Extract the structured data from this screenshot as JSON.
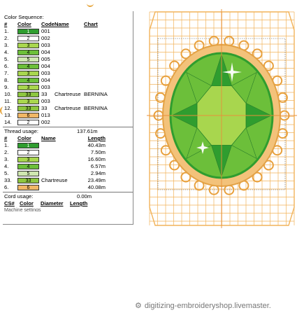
{
  "panel": {
    "color_sequence_title": "Color Sequence:",
    "seq_headers": [
      "#",
      "Color",
      "Code",
      "Name",
      "Chart"
    ],
    "sequence": [
      {
        "num": "1.",
        "swatch": "1",
        "code": "001",
        "name": "",
        "chart": "",
        "color": "#2f9d2f",
        "text_color": "#ffffff"
      },
      {
        "num": "2.",
        "swatch": "2",
        "code": "002",
        "name": "",
        "chart": "",
        "color": "#ffffff",
        "text_color": "#000000"
      },
      {
        "num": "3.",
        "swatch": "3",
        "code": "003",
        "name": "",
        "chart": "",
        "color": "#a8d64e",
        "text_color": "#000000"
      },
      {
        "num": "4.",
        "swatch": "4",
        "code": "004",
        "name": "",
        "chart": "",
        "color": "#6cbf3a",
        "text_color": "#000000"
      },
      {
        "num": "5.",
        "swatch": "5",
        "code": "005",
        "name": "",
        "chart": "",
        "color": "#cfe7b0",
        "text_color": "#000000"
      },
      {
        "num": "6.",
        "swatch": "4",
        "code": "004",
        "name": "",
        "chart": "",
        "color": "#6cbf3a",
        "text_color": "#000000"
      },
      {
        "num": "7.",
        "swatch": "3",
        "code": "003",
        "name": "",
        "chart": "",
        "color": "#a8d64e",
        "text_color": "#000000"
      },
      {
        "num": "8.",
        "swatch": "4",
        "code": "004",
        "name": "",
        "chart": "",
        "color": "#6cbf3a",
        "text_color": "#000000"
      },
      {
        "num": "9.",
        "swatch": "3",
        "code": "003",
        "name": "",
        "chart": "",
        "color": "#a8d64e",
        "text_color": "#000000"
      },
      {
        "num": "10.",
        "swatch": "33",
        "code": "33",
        "name": "Chartreuse",
        "chart": "BERNINA",
        "color": "#8dc63f",
        "text_color": "#000000"
      },
      {
        "num": "11.",
        "swatch": "3",
        "code": "003",
        "name": "",
        "chart": "",
        "color": "#a8d64e",
        "text_color": "#000000"
      },
      {
        "num": "12.",
        "swatch": "33",
        "code": "33",
        "name": "Chartreuse",
        "chart": "BERNINA",
        "color": "#8dc63f",
        "text_color": "#000000"
      },
      {
        "num": "13.",
        "swatch": "6",
        "code": "013",
        "name": "",
        "chart": "",
        "color": "#f0b766",
        "text_color": "#000000"
      },
      {
        "num": "14.",
        "swatch": "2",
        "code": "002",
        "name": "",
        "chart": "",
        "color": "#ffffff",
        "text_color": "#000000"
      }
    ],
    "thread_usage_label": "Thread usage:",
    "thread_usage_value": "137.61m",
    "thread_headers": [
      "#",
      "Color",
      "Name",
      "Length"
    ],
    "threads": [
      {
        "num": "1.",
        "swatch": "1",
        "name": "",
        "length": "40.43m",
        "color": "#2f9d2f",
        "text_color": "#ffffff"
      },
      {
        "num": "2.",
        "swatch": "2",
        "name": "",
        "length": "7.50m",
        "color": "#ffffff",
        "text_color": "#000000"
      },
      {
        "num": "3.",
        "swatch": "3",
        "name": "",
        "length": "16.60m",
        "color": "#a8d64e",
        "text_color": "#000000"
      },
      {
        "num": "4.",
        "swatch": "4",
        "name": "",
        "length": "6.57m",
        "color": "#6cbf3a",
        "text_color": "#000000"
      },
      {
        "num": "5.",
        "swatch": "5",
        "name": "",
        "length": "2.94m",
        "color": "#cfe7b0",
        "text_color": "#000000"
      },
      {
        "num": "33.",
        "swatch": "33",
        "name": "Chartreuse",
        "length": "23.49m",
        "color": "#8dc63f",
        "text_color": "#000000"
      },
      {
        "num": "6.",
        "swatch": "6",
        "name": "",
        "length": "40.08m",
        "color": "#f0b766",
        "text_color": "#000000"
      }
    ],
    "cord_usage_label": "Cord usage:",
    "cord_usage_value": "0.00m",
    "cord_headers": [
      "CS#",
      "Color",
      "Diameter",
      "Length"
    ],
    "cut_text": "Machine settings"
  },
  "design": {
    "grid_color": "#f2b35a",
    "border_color": "#e8a03c",
    "green_dark": "#2f9d2f",
    "green_mid": "#6cbf3a",
    "green_light": "#a8d64e",
    "orange": "#f0b766"
  },
  "watermark": "digitizing-embroideryshop.livemaster."
}
